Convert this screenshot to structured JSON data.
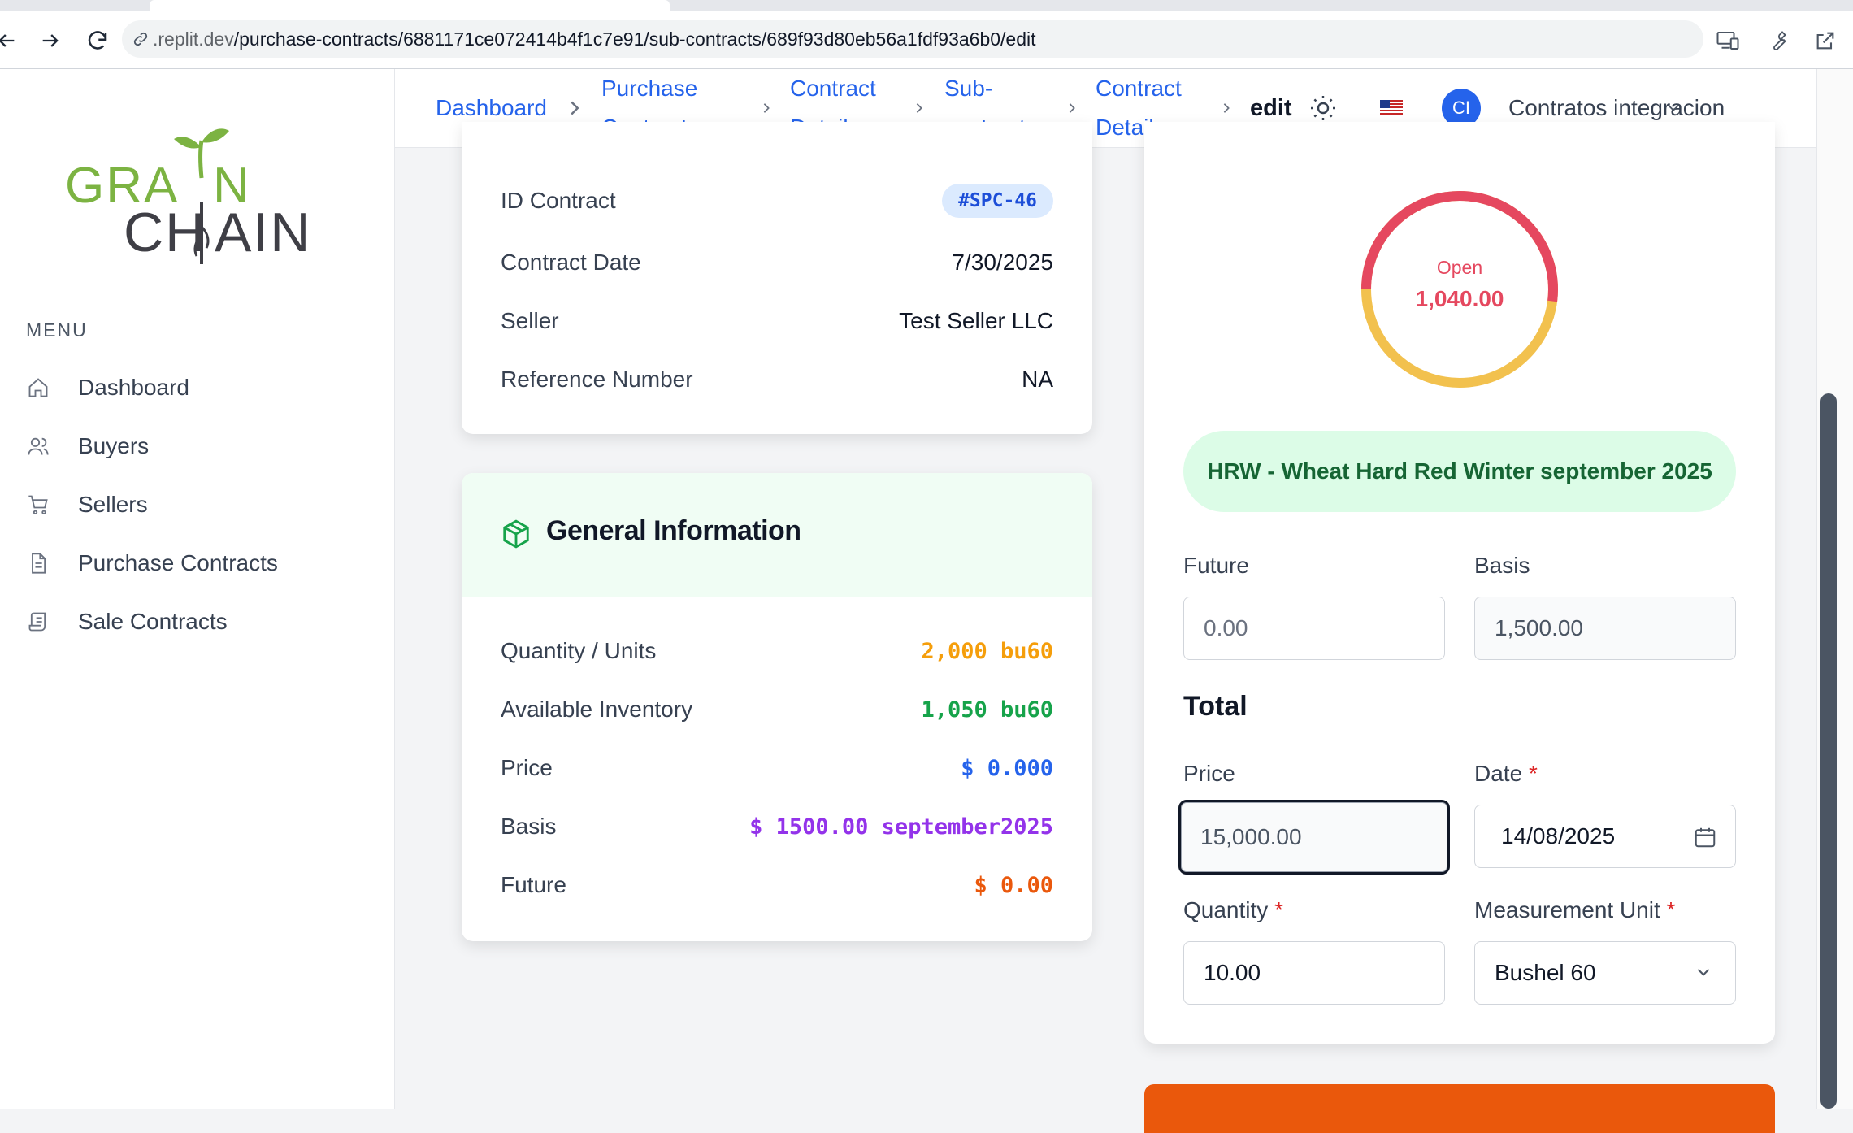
{
  "browser": {
    "url_host": ".replit.dev",
    "url_path": "/purchase-contracts/6881171ce072414b4f1c7e91/sub-contracts/689f93d80eb56a1fdf93a6b0/edit"
  },
  "sidebar": {
    "logo": {
      "line1": "GRAIN",
      "line2": "CHAIN"
    },
    "menu_title": "MENU",
    "items": [
      {
        "label": "Dashboard",
        "icon": "home-icon"
      },
      {
        "label": "Buyers",
        "icon": "users-icon"
      },
      {
        "label": "Sellers",
        "icon": "cart-icon"
      },
      {
        "label": "Purchase Contracts",
        "icon": "document-icon"
      },
      {
        "label": "Sale Contracts",
        "icon": "scroll-icon"
      }
    ]
  },
  "header": {
    "breadcrumbs": [
      {
        "line1": "Dashboard",
        "line2": ""
      },
      {
        "line1": "Purchase",
        "line2": "Contracts"
      },
      {
        "line1": "Contract",
        "line2": "Detail"
      },
      {
        "line1": "Sub-",
        "line2": "contracts"
      },
      {
        "line1": "Contract",
        "line2": "Detail"
      }
    ],
    "current": "edit",
    "avatar_initials": "CI",
    "user_name": "Contratos integracion"
  },
  "contract_card": {
    "rows": [
      {
        "label": "ID Contract",
        "value": "#SPC-46"
      },
      {
        "label": "Contract Date",
        "value": "7/30/2025"
      },
      {
        "label": "Seller",
        "value": "Test Seller LLC"
      },
      {
        "label": "Reference Number",
        "value": "NA"
      }
    ]
  },
  "general_info": {
    "title": "General Information",
    "rows": [
      {
        "label": "Quantity / Units",
        "value": "2,000 bu60",
        "color": "#f59e0b"
      },
      {
        "label": "Available Inventory",
        "value": "1,050 bu60",
        "color": "#16a34a"
      },
      {
        "label": "Price",
        "value": "$ 0.000",
        "color": "#2563eb"
      },
      {
        "label": "Basis",
        "value": "$ 1500.00 september2025",
        "color": "#9333ea"
      },
      {
        "label": "Future",
        "value": "$ 0.00",
        "color": "#ea580c"
      }
    ]
  },
  "form": {
    "donut": {
      "label": "Open",
      "value": "1,040.00",
      "open_fraction": 0.52,
      "open_color": "#e5485f",
      "other_color": "#f2c14e"
    },
    "commodity": "HRW - Wheat Hard Red Winter september 2025",
    "future": {
      "label": "Future",
      "placeholder": "0.00"
    },
    "basis": {
      "label": "Basis",
      "value": "1,500.00"
    },
    "total_title": "Total",
    "price": {
      "label": "Price",
      "value": "15,000.00"
    },
    "date": {
      "label": "Date",
      "required": "*",
      "value": "14/08/2025"
    },
    "quantity": {
      "label": "Quantity",
      "required": "*",
      "value": "10.00"
    },
    "unit": {
      "label": "Measurement Unit",
      "required": "*",
      "value": "Bushel 60"
    }
  }
}
